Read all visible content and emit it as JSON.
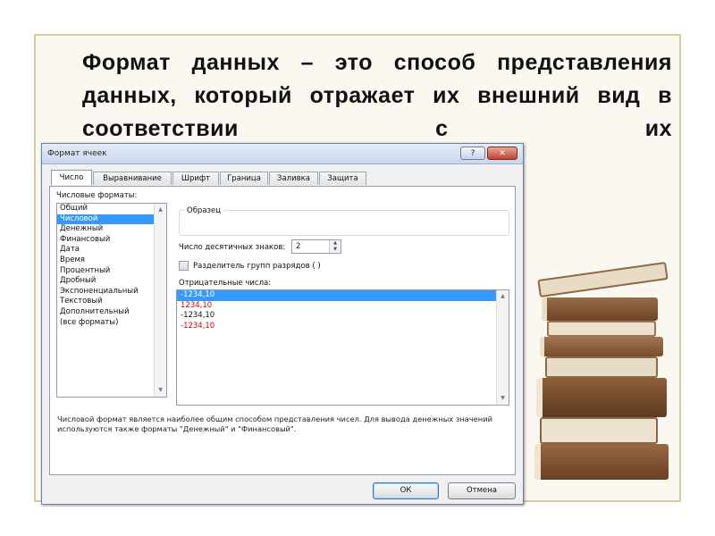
{
  "slide": {
    "heading": "Формат данных – это способ представления данных, который отражает их внешний вид в соответствии с их"
  },
  "dialog": {
    "title": "Формат ячеек",
    "help_label": "?",
    "close_label": "✕",
    "tabs": [
      "Число",
      "Выравнивание",
      "Шрифт",
      "Граница",
      "Заливка",
      "Защита"
    ],
    "active_tab": "Число",
    "formats_label": "Числовые форматы:",
    "formats": [
      "Общий",
      "Числовой",
      "Денежный",
      "Финансовый",
      "Дата",
      "Время",
      "Процентный",
      "Дробный",
      "Экспоненциальный",
      "Текстовый",
      "Дополнительный",
      "(все форматы)"
    ],
    "selected_format": "Числовой",
    "sample_label": "Образец",
    "decimals_label": "Число десятичных знаков:",
    "decimals_value": "2",
    "separator_label": "Разделитель групп разрядов ( )",
    "negative_label": "Отрицательные числа:",
    "negative_numbers": [
      "-1234,10",
      "1234,10",
      "-1234,10",
      "-1234,10"
    ],
    "description": "Числовой формат является наиболее общим способом представления чисел. Для вывода денежных значений используются также форматы \"Денежный\" и \"Финансовый\".",
    "ok_label": "ОК",
    "cancel_label": "Отмена"
  },
  "colors": {
    "selection": "#3399ff",
    "negative_red": "#d60000"
  },
  "icons": {
    "help": "question-icon",
    "close": "close-icon",
    "illustration": "book-stack-icon"
  }
}
